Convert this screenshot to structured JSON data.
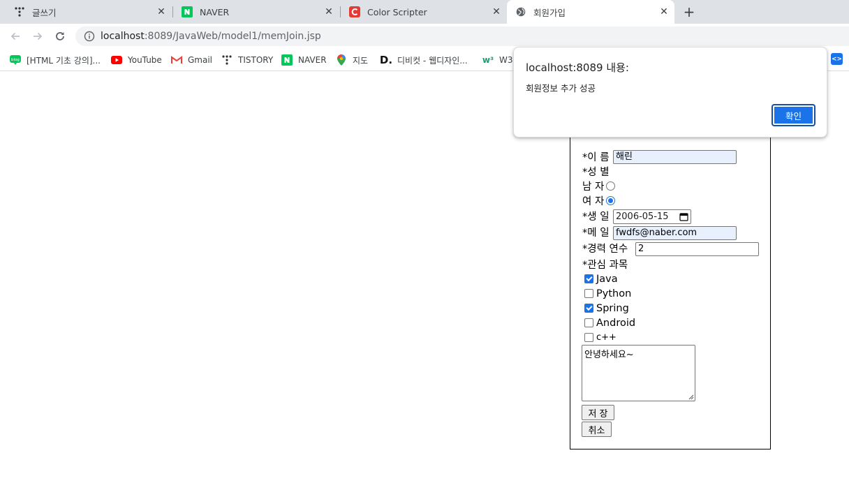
{
  "tabs": [
    {
      "title": "글쓰기",
      "icon": "tistory-icon"
    },
    {
      "title": "NAVER",
      "icon": "naver-icon"
    },
    {
      "title": "Color Scripter",
      "icon": "color-scripter-icon"
    },
    {
      "title": "회원가입",
      "icon": "globe-icon",
      "active": true
    }
  ],
  "toolbar": {
    "url_host": "localhost",
    "url_rest": ":8089/JavaWeb/model1/memJoin.jsp"
  },
  "bookmarks": [
    {
      "label": "[HTML 기초 강의]...",
      "icon": "blog-icon"
    },
    {
      "label": "YouTube",
      "icon": "youtube-icon"
    },
    {
      "label": "Gmail",
      "icon": "gmail-icon"
    },
    {
      "label": "TISTORY",
      "icon": "tistory-icon"
    },
    {
      "label": "NAVER",
      "icon": "naver-icon"
    },
    {
      "label": "지도",
      "icon": "maps-pin-icon"
    },
    {
      "label": "디비컷 - 웹디자인...",
      "icon": "dbcut-icon"
    },
    {
      "label": "W3S",
      "icon": "w3schools-icon"
    }
  ],
  "form": {
    "name_label": "*이 름",
    "name_value": "해린",
    "gender_label": "*성 별",
    "male_label": "남 자",
    "female_label": "여 자",
    "gender_selected": "여 자",
    "birth_label": "*생 일",
    "birth_value": "2006-05-15",
    "email_label": "*메 일",
    "email_value": "fwdfs@naber.com",
    "career_label": "*경력 연수",
    "career_value": "2",
    "interest_label": "*관심 과목",
    "interests": [
      {
        "label": "Java",
        "checked": true
      },
      {
        "label": "Python",
        "checked": false
      },
      {
        "label": "Spring",
        "checked": true
      },
      {
        "label": "Android",
        "checked": false
      },
      {
        "label": "c++",
        "checked": false
      }
    ],
    "memo": "안녕하세요~",
    "save_label": "저 장",
    "cancel_label": "취소"
  },
  "dialog": {
    "title": "localhost:8089 내용:",
    "message": "회원정보 추가 성공",
    "ok_label": "확인"
  },
  "colors": {
    "accent": "#1a73e8",
    "tabstrip": "#dee1e6",
    "omnibox": "#f1f3f4",
    "autofill": "#e8f0fe"
  }
}
